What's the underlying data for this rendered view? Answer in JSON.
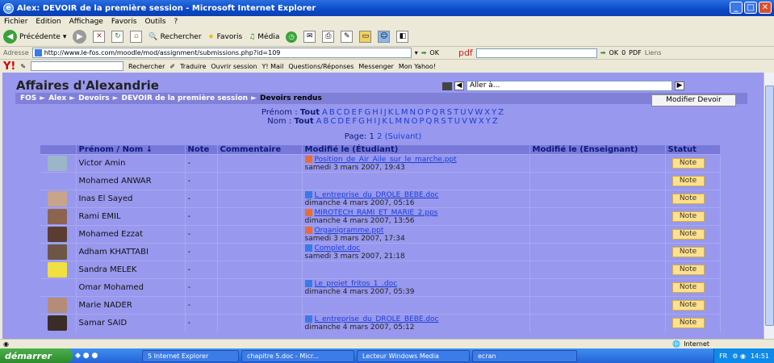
{
  "window": {
    "title": "Alex: DEVOIR de la première session - Microsoft Internet Explorer"
  },
  "menu": [
    "Fichier",
    "Edition",
    "Affichage",
    "Favoris",
    "Outils",
    "?"
  ],
  "toolbar": {
    "back": "Précédente",
    "search": "Rechercher",
    "favorites": "Favoris",
    "media": "Média"
  },
  "address": {
    "label": "Adresse",
    "url": "http://www.le-fos.com/moodle/mod/assignment/submissions.php?id=109",
    "go": "OK",
    "links": "Liens",
    "pdf": "pdf",
    "ok2": "OK",
    "zero": "0",
    "pdf2": "PDF"
  },
  "yahoo": {
    "search": "Rechercher",
    "translate": "Traduire",
    "open_session": "Ouvrir session",
    "mail": "Y! Mail",
    "questions": "Questions/Réponses",
    "messenger": "Messenger",
    "my_yahoo": "Mon Yahoo!"
  },
  "page": {
    "site_title": "Affaires d'Alexandrie",
    "jump_placeholder": "Aller à...",
    "breadcrumb": [
      "FOS",
      "Alex",
      "Devoirs",
      "DEVOIR de la première session"
    ],
    "breadcrumb_current": "Devoirs rendus",
    "modify_button": "Modifier Devoir"
  },
  "filters": {
    "prenom_label": "Prénom :",
    "nom_label": "Nom :",
    "all": "Tout",
    "letters": [
      "A",
      "B",
      "C",
      "D",
      "E",
      "F",
      "G",
      "H",
      "I",
      "J",
      "K",
      "L",
      "M",
      "N",
      "O",
      "P",
      "Q",
      "R",
      "S",
      "T",
      "U",
      "V",
      "W",
      "X",
      "Y",
      "Z"
    ]
  },
  "pager": {
    "label": "Page:",
    "pages": [
      "1",
      "2"
    ],
    "next": "(Suivant)"
  },
  "table": {
    "headers": {
      "name": "Prénom / Nom",
      "grade": "Note",
      "comment": "Commentaire",
      "modified_student": "Modifié le (Étudiant)",
      "modified_teacher": "Modifié le (Enseignant)",
      "status": "Statut"
    },
    "rows": [
      {
        "name": "Victor Amin",
        "grade": "-",
        "file": "Position_de_Air_Aile_sur_le_marche.ppt",
        "date": "samedi 3 mars 2007, 19:43",
        "status": "Note",
        "avatar_color": "#9bb6c8",
        "file_type": "ppt"
      },
      {
        "name": "Mohamed ANWAR",
        "grade": "-",
        "file": "",
        "date": "",
        "status": "Note",
        "avatar_color": "",
        "file_type": ""
      },
      {
        "name": "Inas El Sayed",
        "grade": "-",
        "file": "L_entreprise_du_DROLE_BEBE.doc",
        "date": "dimanche 4 mars 2007, 05:16",
        "status": "Note",
        "avatar_color": "#c8a48c",
        "file_type": "doc"
      },
      {
        "name": "Rami EMIL",
        "grade": "-",
        "file": "MIROTECH_RAMI_ET_MARIE_2.pps",
        "date": "dimanche 4 mars 2007, 13:56",
        "status": "Note",
        "avatar_color": "#8c6450",
        "file_type": "ppt"
      },
      {
        "name": "Mohamed Ezzat",
        "grade": "-",
        "file": "Organigramme.ppt",
        "date": "samedi 3 mars 2007, 17:34",
        "status": "Note",
        "avatar_color": "#5a3c32",
        "file_type": "ppt"
      },
      {
        "name": "Adham KHATTABI",
        "grade": "-",
        "file": "Complet.doc",
        "date": "samedi 3 mars 2007, 21:18",
        "status": "Note",
        "avatar_color": "#6e5646",
        "file_type": "doc"
      },
      {
        "name": "Sandra MELEK",
        "grade": "-",
        "file": "",
        "date": "",
        "status": "Note",
        "avatar_color": "#f0e040",
        "file_type": ""
      },
      {
        "name": "Omar Mohamed",
        "grade": "-",
        "file": "Le_projet_fritos_1_.doc",
        "date": "dimanche 4 mars 2007, 05:39",
        "status": "Note",
        "avatar_color": "",
        "file_type": "doc"
      },
      {
        "name": "Marie NADER",
        "grade": "-",
        "file": "",
        "date": "",
        "status": "Note",
        "avatar_color": "#b48c78",
        "file_type": ""
      },
      {
        "name": "Samar SAID",
        "grade": "-",
        "file": "L_entreprise_du_DROLE_BEBE.doc",
        "date": "dimanche 4 mars 2007, 05:12",
        "status": "Note",
        "avatar_color": "#3c2c28",
        "file_type": "doc"
      }
    ]
  },
  "statusbar": {
    "zone": "Internet"
  },
  "taskbar": {
    "start": "démarrer",
    "items": [
      "5 Internet Explorer",
      "chapitre 5.doc - Micr...",
      "Lecteur Windows Media",
      "ecran"
    ],
    "lang": "FR",
    "time": "14:51"
  }
}
